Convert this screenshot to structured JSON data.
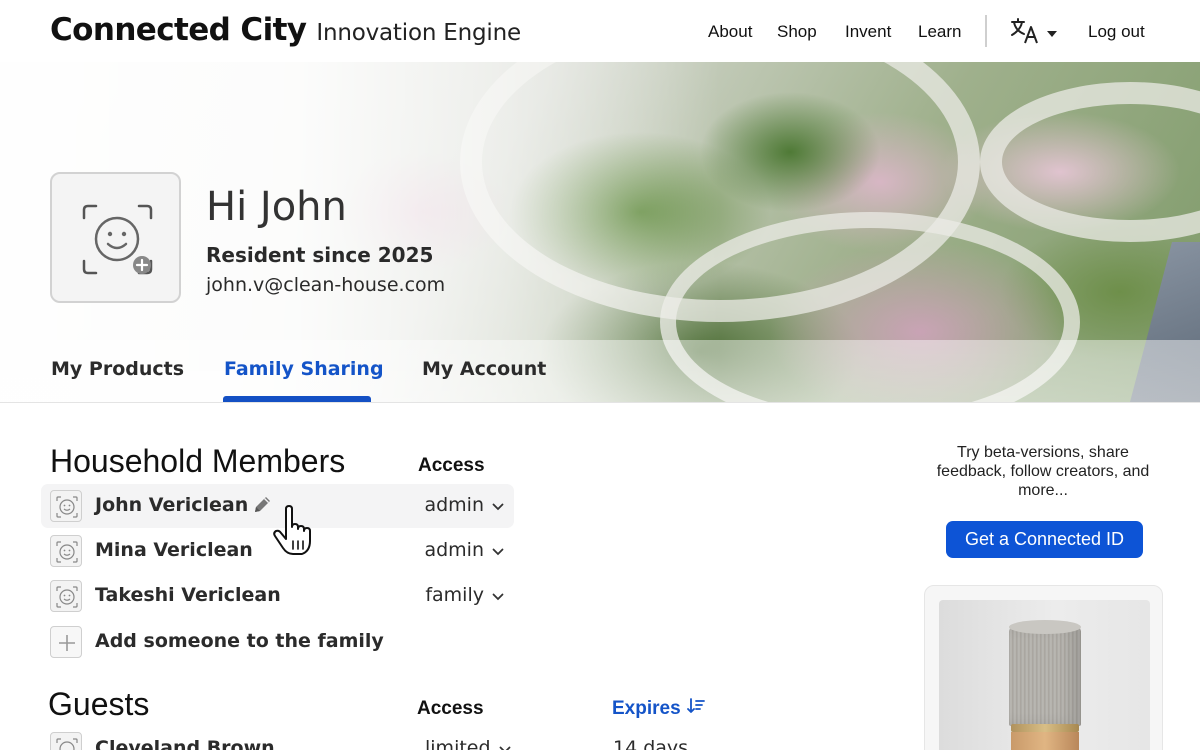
{
  "header": {
    "brand_main": "Connected City",
    "brand_sub": "Innovation Engine",
    "nav": [
      "About",
      "Shop",
      "Invent",
      "Learn"
    ],
    "logout_label": "Log out",
    "language_icon": "translate-icon"
  },
  "profile": {
    "greeting": "Hi John",
    "resident_since": "Resident since 2025",
    "email": "john.v@clean-house.com"
  },
  "tabs": [
    {
      "label": "My Products",
      "active": false
    },
    {
      "label": "Family Sharing",
      "active": true
    },
    {
      "label": "My Account",
      "active": false
    }
  ],
  "household": {
    "title": "Household Members",
    "access_header": "Access",
    "members": [
      {
        "name": "John Vericlean",
        "access": "admin"
      },
      {
        "name": "Mina Vericlean",
        "access": "admin"
      },
      {
        "name": "Takeshi Vericlean",
        "access": "family"
      }
    ],
    "add_label": "Add someone to the family"
  },
  "guests": {
    "title": "Guests",
    "access_header": "Access",
    "expires_header": "Expires",
    "rows": [
      {
        "name": "Cleveland Brown",
        "access": "limited",
        "expires": "14 days"
      }
    ]
  },
  "sidebar": {
    "promo_text": "Try beta-versions, share feedback, follow creators, and more...",
    "cta_label": "Get a Connected ID"
  },
  "colors": {
    "accent": "#1454c8",
    "cta": "#0d54d6"
  }
}
